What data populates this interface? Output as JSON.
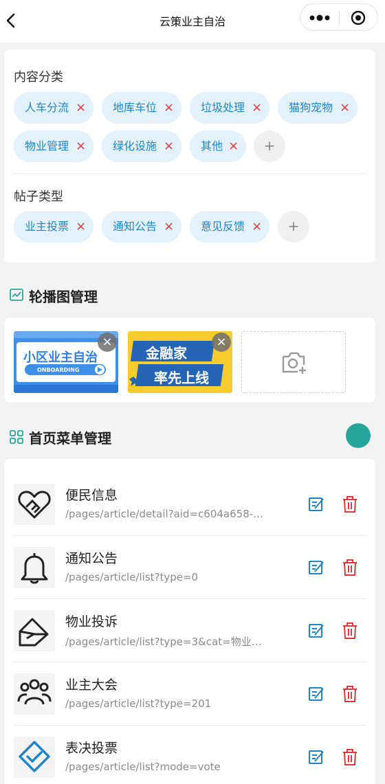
{
  "nav": {
    "title": "云策业主自治",
    "back_icon": "chevron-left-icon",
    "more_icon": "more-dots-icon",
    "close_icon": "target-close-icon"
  },
  "content_categories": {
    "label": "内容分类",
    "tags": [
      "人车分流",
      "地库车位",
      "垃圾处理",
      "猫狗宠物",
      "物业管理",
      "绿化设施",
      "其他"
    ],
    "add_label": "+",
    "remove_label": "×"
  },
  "post_types": {
    "label": "帖子类型",
    "tags": [
      "业主投票",
      "通知公告",
      "意见反馈"
    ],
    "add_label": "+"
  },
  "carousel": {
    "title": "轮播图管理",
    "icon": "image-chart-icon",
    "banners": [
      {
        "text": "小区业主自治",
        "sub": "ONBOARDING"
      },
      {
        "text1": "金融家",
        "text2": "率先上线"
      }
    ],
    "remove_label": "×",
    "upload_icon": "camera-plus-icon"
  },
  "menu": {
    "title": "首页菜单管理",
    "icon": "grid-icon",
    "toggle_color": "#26a69a",
    "items": [
      {
        "name": "便民信息",
        "path": "/pages/article/detail?aid=c604a658-…",
        "icon": "handshake-heart-icon"
      },
      {
        "name": "通知公告",
        "path": "/pages/article/list?type=0",
        "icon": "bell-icon"
      },
      {
        "name": "物业投诉",
        "path": "/pages/article/list?type=3&cat=物业…",
        "icon": "envelope-icon"
      },
      {
        "name": "业主大会",
        "path": "/pages/article/list?type=201",
        "icon": "people-group-icon"
      },
      {
        "name": "表决投票",
        "path": "/pages/article/list?mode=vote",
        "icon": "vote-check-icon"
      }
    ]
  },
  "colors": {
    "accent": "#1e85c9",
    "tag_bg": "#e3f1fb",
    "danger": "#e0353a",
    "teal": "#26a69a"
  }
}
